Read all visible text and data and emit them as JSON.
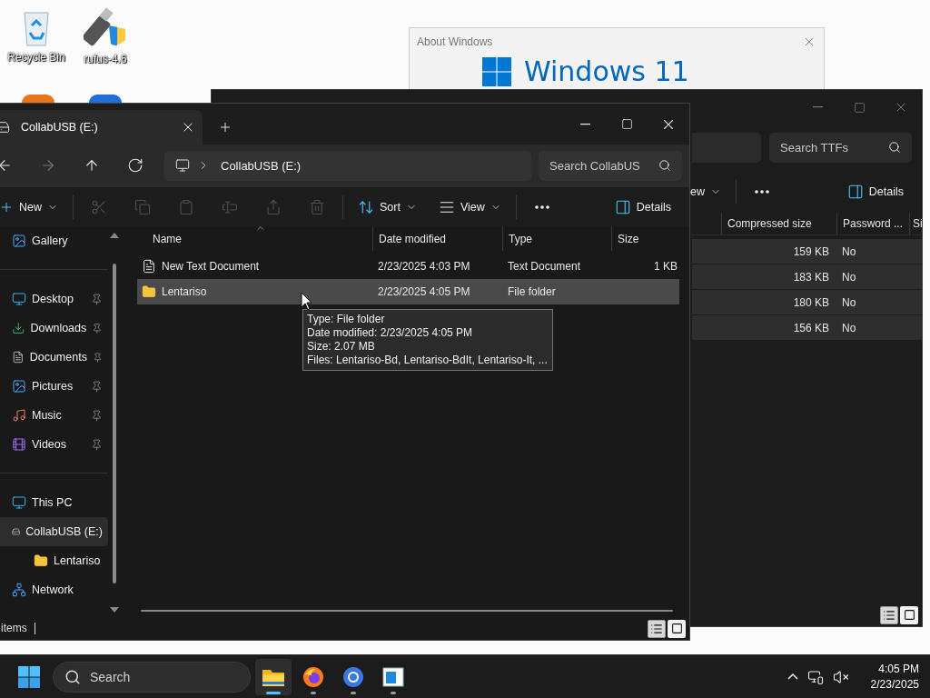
{
  "desktop": {
    "icons": [
      {
        "label": "Recycle Bin",
        "kind": "recycle"
      },
      {
        "label": "rufus-4.6",
        "kind": "usb"
      }
    ]
  },
  "about_window": {
    "title": "About Windows",
    "logo_text": "Windows 11"
  },
  "back_window": {
    "search": {
      "placeholder": "Search TTFs"
    },
    "commands": [
      {
        "kind": "view",
        "label": "ew"
      },
      {
        "kind": "more"
      },
      {
        "kind": "details",
        "label": "Details"
      }
    ],
    "columns": [
      "Compressed size",
      "Password ...",
      "Si"
    ],
    "rows": [
      {
        "compressed_size": "159 KB",
        "password": "No",
        "selected": true
      },
      {
        "compressed_size": "183 KB",
        "password": "No",
        "selected": true
      },
      {
        "compressed_size": "180 KB",
        "password": "No",
        "selected": true
      },
      {
        "compressed_size": "156 KB",
        "password": "No",
        "selected": true
      }
    ],
    "views": [
      {
        "kind": "details",
        "selected": true
      },
      {
        "kind": "tiles",
        "selected": false
      }
    ]
  },
  "explorer": {
    "tab": {
      "title": "CollabUSB (E:)",
      "selected": true
    },
    "nav": [
      {
        "kind": "back",
        "disabled": false
      },
      {
        "kind": "forward",
        "disabled": true
      },
      {
        "kind": "up",
        "disabled": false
      },
      {
        "kind": "refresh",
        "disabled": false
      }
    ],
    "address": [
      "CollabUSB (E:)"
    ],
    "search": {
      "placeholder": "Search CollabUS"
    },
    "commands": [
      {
        "kind": "new",
        "label": "New",
        "disabled": false
      },
      {
        "kind": "cut",
        "disabled": true
      },
      {
        "kind": "copy",
        "disabled": true
      },
      {
        "kind": "paste",
        "disabled": true
      },
      {
        "kind": "rename",
        "disabled": true
      },
      {
        "kind": "share",
        "disabled": true
      },
      {
        "kind": "delete",
        "disabled": true
      },
      {
        "kind": "sort",
        "label": "Sort",
        "disabled": false
      },
      {
        "kind": "view",
        "label": "View",
        "disabled": false
      },
      {
        "kind": "more",
        "disabled": false
      },
      {
        "kind": "details",
        "label": "Details",
        "disabled": false
      }
    ],
    "sidebar": {
      "groups": [
        [
          {
            "label": "Gallery",
            "kind": "gallery",
            "pinned": false,
            "selected": false
          }
        ],
        [
          {
            "label": "Desktop",
            "kind": "desktop",
            "pinned": true,
            "selected": false
          },
          {
            "label": "Downloads",
            "kind": "downloads",
            "pinned": true,
            "selected": false
          },
          {
            "label": "Documents",
            "kind": "documents",
            "pinned": true,
            "selected": false
          },
          {
            "label": "Pictures",
            "kind": "pictures",
            "pinned": true,
            "selected": false
          },
          {
            "label": "Music",
            "kind": "music",
            "pinned": true,
            "selected": false
          },
          {
            "label": "Videos",
            "kind": "videos",
            "pinned": true,
            "selected": false
          }
        ],
        [
          {
            "label": "This PC",
            "kind": "pc",
            "pinned": false,
            "selected": false
          },
          {
            "label": "CollabUSB (E:)",
            "kind": "drive",
            "pinned": false,
            "selected": true,
            "children": [
              {
                "label": "Lentariso",
                "kind": "folder",
                "pinned": false,
                "selected": false
              }
            ]
          },
          {
            "label": "Network",
            "kind": "network",
            "pinned": false,
            "selected": false
          }
        ]
      ]
    },
    "columns": [
      "Name",
      "Date modified",
      "Type",
      "Size"
    ],
    "files": [
      {
        "name": "New Text Document",
        "date": "2/23/2025 4:03 PM",
        "type": "Text Document",
        "size": "1 KB",
        "kind": "text",
        "selected": false
      },
      {
        "name": "Lentariso",
        "date": "2/23/2025 4:05 PM",
        "type": "File folder",
        "kind": "folder",
        "selected": true
      }
    ],
    "tooltip": [
      "Type: File folder",
      "Date modified: 2/23/2025 4:05 PM",
      "Size: 2.07 MB",
      "Files: Lentariso-Bd, Lentariso-BdIt, Lentariso-It, ..."
    ],
    "status": "items",
    "views": [
      {
        "kind": "details",
        "selected": true
      },
      {
        "kind": "tiles",
        "selected": false
      }
    ]
  },
  "taskbar": {
    "search": {
      "placeholder": "Search"
    },
    "apps": [
      {
        "kind": "explorer",
        "active": true
      },
      {
        "kind": "browser-fox",
        "active": false
      },
      {
        "kind": "browser-ring",
        "active": false
      },
      {
        "kind": "window-app",
        "active": false
      }
    ],
    "clock": {
      "time": "4:05 PM",
      "date": "2/23/2025"
    }
  }
}
